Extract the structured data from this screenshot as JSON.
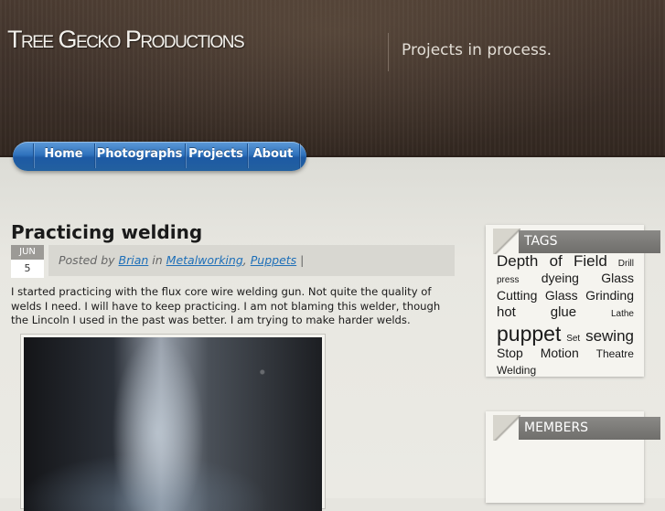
{
  "site": {
    "title": "Tree Gecko Productions",
    "tagline": "Projects in process."
  },
  "nav": {
    "items": [
      {
        "label": "Home"
      },
      {
        "label": "Photographs"
      },
      {
        "label": "Projects"
      },
      {
        "label": "About"
      }
    ]
  },
  "post": {
    "title": "Practicing welding",
    "date_month": "JUN",
    "date_day": "5",
    "posted_by_prefix": "Posted by",
    "author": "Brian",
    "in_label": "in",
    "category_1": "Metalworking",
    "category_sep": ",",
    "category_2": "Puppets",
    "meta_suffix": "|",
    "body": "I started practicing with the flux core wire welding gun. Not quite the quality of welds I need. I will have to keep practicing. I am not blaming this welder, though the Lincoln I used in the past was better. I am trying to make harder welds."
  },
  "sidebar": {
    "tags_title": "TAGS",
    "members_title": "MEMBERS",
    "tags": [
      {
        "label": "Depth of Field",
        "size": 17
      },
      {
        "label": "Drill",
        "size": 10
      },
      {
        "label": "press",
        "size": 10
      },
      {
        "label": "dyeing",
        "size": 14
      },
      {
        "label": "Glass",
        "size": 14
      },
      {
        "label": "Cutting",
        "size": 14
      },
      {
        "label": "Glass",
        "size": 14
      },
      {
        "label": "Grinding",
        "size": 14
      },
      {
        "label": "hot",
        "size": 15
      },
      {
        "label": "glue",
        "size": 15
      },
      {
        "label": "Lathe",
        "size": 10
      },
      {
        "label": "puppet",
        "size": 23
      },
      {
        "label": "Set",
        "size": 10
      },
      {
        "label": "sewing",
        "size": 17
      },
      {
        "label": "Stop",
        "size": 14
      },
      {
        "label": "Motion",
        "size": 14
      },
      {
        "label": "Theatre",
        "size": 12
      },
      {
        "label": "Welding",
        "size": 12
      }
    ]
  }
}
